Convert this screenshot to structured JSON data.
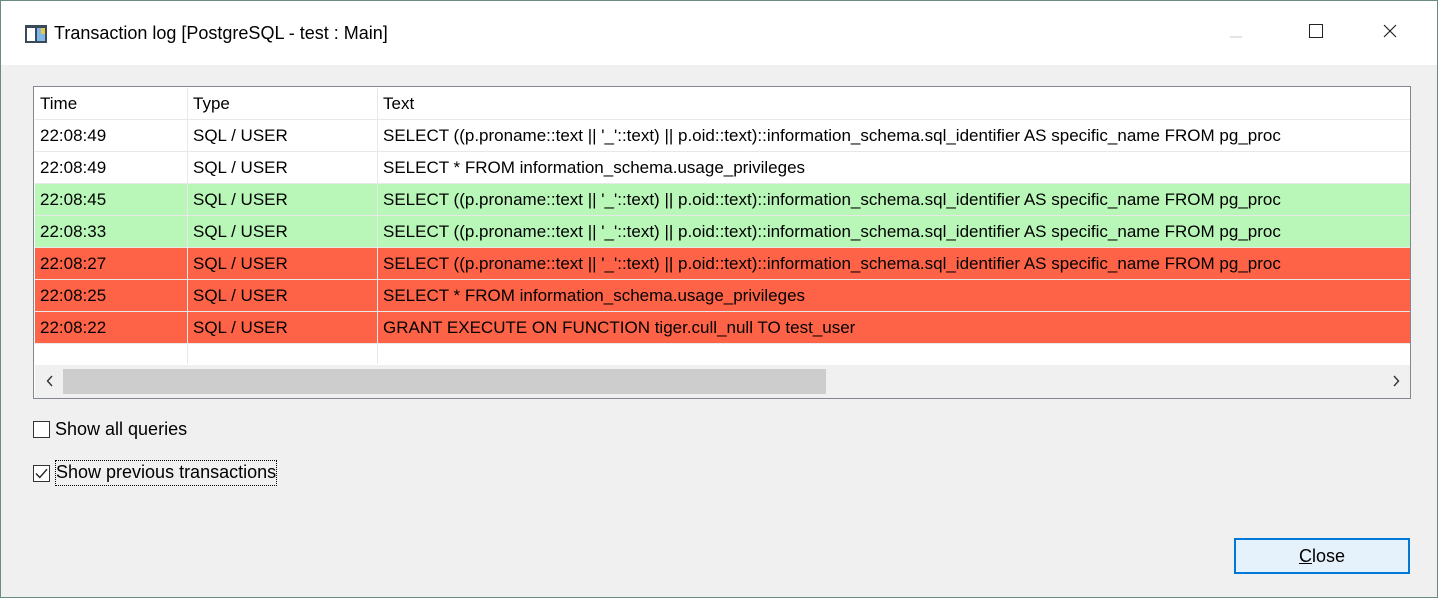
{
  "window": {
    "title": "Transaction log [PostgreSQL - test : Main]"
  },
  "table": {
    "columns": [
      "Time",
      "Type",
      "Text"
    ],
    "rows": [
      {
        "time": "22:08:49",
        "type": "SQL / USER",
        "text": "SELECT ((p.proname::text || '_'::text) || p.oid::text)::information_schema.sql_identifier AS specific_name FROM pg_proc",
        "status": "none"
      },
      {
        "time": "22:08:49",
        "type": "SQL / USER",
        "text": "SELECT * FROM information_schema.usage_privileges",
        "status": "none"
      },
      {
        "time": "22:08:45",
        "type": "SQL / USER",
        "text": "SELECT ((p.proname::text || '_'::text) || p.oid::text)::information_schema.sql_identifier AS specific_name FROM pg_proc",
        "status": "success"
      },
      {
        "time": "22:08:33",
        "type": "SQL / USER",
        "text": "SELECT ((p.proname::text || '_'::text) || p.oid::text)::information_schema.sql_identifier AS specific_name FROM pg_proc",
        "status": "success"
      },
      {
        "time": "22:08:27",
        "type": "SQL / USER",
        "text": "SELECT ((p.proname::text || '_'::text) || p.oid::text)::information_schema.sql_identifier AS specific_name FROM pg_proc",
        "status": "error"
      },
      {
        "time": "22:08:25",
        "type": "SQL / USER",
        "text": "SELECT * FROM information_schema.usage_privileges",
        "status": "error"
      },
      {
        "time": "22:08:22",
        "type": "SQL / USER",
        "text": "GRANT EXECUTE ON FUNCTION tiger.cull_null TO test_user",
        "status": "error"
      }
    ]
  },
  "options": {
    "show_all_queries": {
      "label": "Show all queries",
      "checked": false
    },
    "show_previous_transactions": {
      "label": "Show previous transactions",
      "checked": true
    }
  },
  "buttons": {
    "close_mnemonic": "C",
    "close_rest": "lose"
  },
  "colors": {
    "success": "#b8f7b8",
    "error": "#ff6347",
    "accent": "#0078d7"
  },
  "icons": {
    "app": "app-icon",
    "minimize": "minimize-icon",
    "maximize": "maximize-icon",
    "close": "close-icon",
    "scroll_left": "chevron-left-icon",
    "scroll_right": "chevron-right-icon",
    "check": "checkmark-icon"
  }
}
